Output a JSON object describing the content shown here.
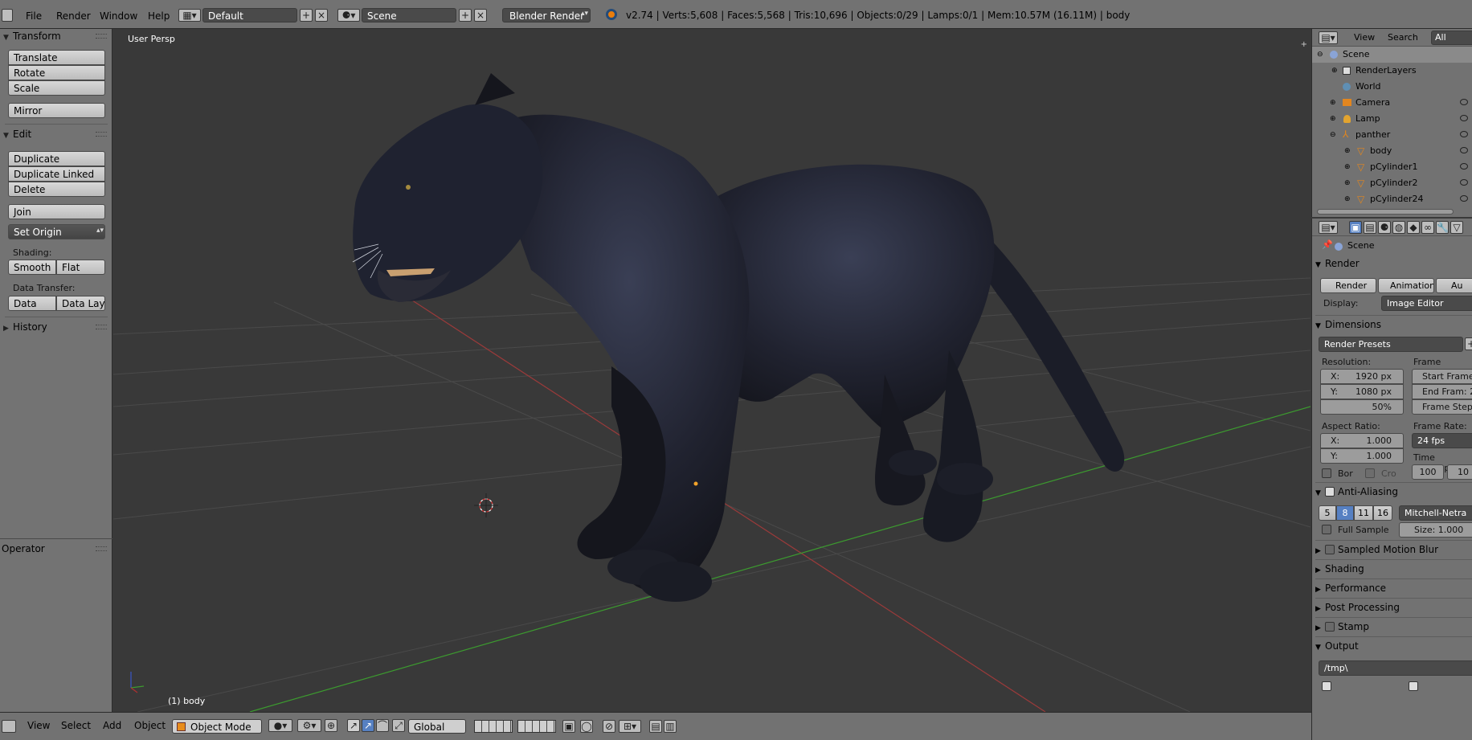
{
  "topbar": {
    "menus": [
      "File",
      "Render",
      "Window",
      "Help"
    ],
    "layout": "Default",
    "scene": "Scene",
    "engine": "Blender Render",
    "stats": "v2.74 | Verts:5,608 | Faces:5,568 | Tris:10,696 | Objects:0/29 | Lamps:0/1 | Mem:10.57M (16.11M) | body"
  },
  "toolshelf": {
    "transform_title": "Transform",
    "translate": "Translate",
    "rotate": "Rotate",
    "scale": "Scale",
    "mirror": "Mirror",
    "edit_title": "Edit",
    "duplicate": "Duplicate",
    "duplicate_linked": "Duplicate Linked",
    "delete": "Delete",
    "join": "Join",
    "set_origin": "Set Origin",
    "shading_label": "Shading:",
    "smooth": "Smooth",
    "flat": "Flat",
    "data_transfer_label": "Data Transfer:",
    "data": "Data",
    "data_layout": "Data Layo",
    "history_title": "History",
    "operator_title": "Operator"
  },
  "viewport": {
    "view_label": "User Persp",
    "object_label": "(1) body"
  },
  "bottombar": {
    "menus": [
      "View",
      "Select",
      "Add",
      "Object"
    ],
    "mode": "Object Mode",
    "orientation": "Global"
  },
  "outliner": {
    "header": [
      "View",
      "Search",
      "All Scenes"
    ],
    "rows": [
      {
        "label": "Scene"
      },
      {
        "label": "RenderLayers"
      },
      {
        "label": "World"
      },
      {
        "label": "Camera"
      },
      {
        "label": "Lamp"
      },
      {
        "label": "panther"
      },
      {
        "label": "body"
      },
      {
        "label": "pCylinder1"
      },
      {
        "label": "pCylinder2"
      },
      {
        "label": "pCylinder24"
      }
    ]
  },
  "properties": {
    "context": "Scene",
    "render_title": "Render",
    "render_btn": "Render",
    "animation_btn": "Animation",
    "audio_btn": "Au",
    "display_label": "Display:",
    "display_value": "Image Editor",
    "dimensions_title": "Dimensions",
    "presets": "Render Presets",
    "resolution_label": "Resolution:",
    "res_x": "X:",
    "res_x_val": "1920 px",
    "res_y": "Y:",
    "res_y_val": "1080 px",
    "res_pct": "50%",
    "frame_range_label": "Frame Range:",
    "start_frame": "Start Frame:",
    "end_frame": "End Fram: 2",
    "frame_step": "Frame Step:",
    "aspect_label": "Aspect Ratio:",
    "asp_x": "X:",
    "asp_x_val": "1.000",
    "asp_y": "Y:",
    "asp_y_val": "1.000",
    "frame_rate_label": "Frame Rate:",
    "fps": "24 fps",
    "time_remap": "Time Remapp",
    "remap_old": "100",
    "remap_new": "10",
    "border": "Bor",
    "crop": "Cro",
    "aa_title": "Anti-Aliasing",
    "aa_samples": [
      "5",
      "8",
      "11",
      "16"
    ],
    "aa_filter": "Mitchell-Netra",
    "full_sample": "Full Sample",
    "size": "Size: 1.000",
    "motion_blur": "Sampled Motion Blur",
    "shading": "Shading",
    "performance": "Performance",
    "post_processing": "Post Processing",
    "stamp": "Stamp",
    "output_title": "Output",
    "output_path": "/tmp\\"
  },
  "colors": {
    "header_bg": "#727272",
    "viewport_bg": "#393939",
    "selection_blue": "#5680c2",
    "x_axis": "#b03030",
    "y_axis": "#3c9b2f",
    "panther": "#1d1f2c"
  }
}
